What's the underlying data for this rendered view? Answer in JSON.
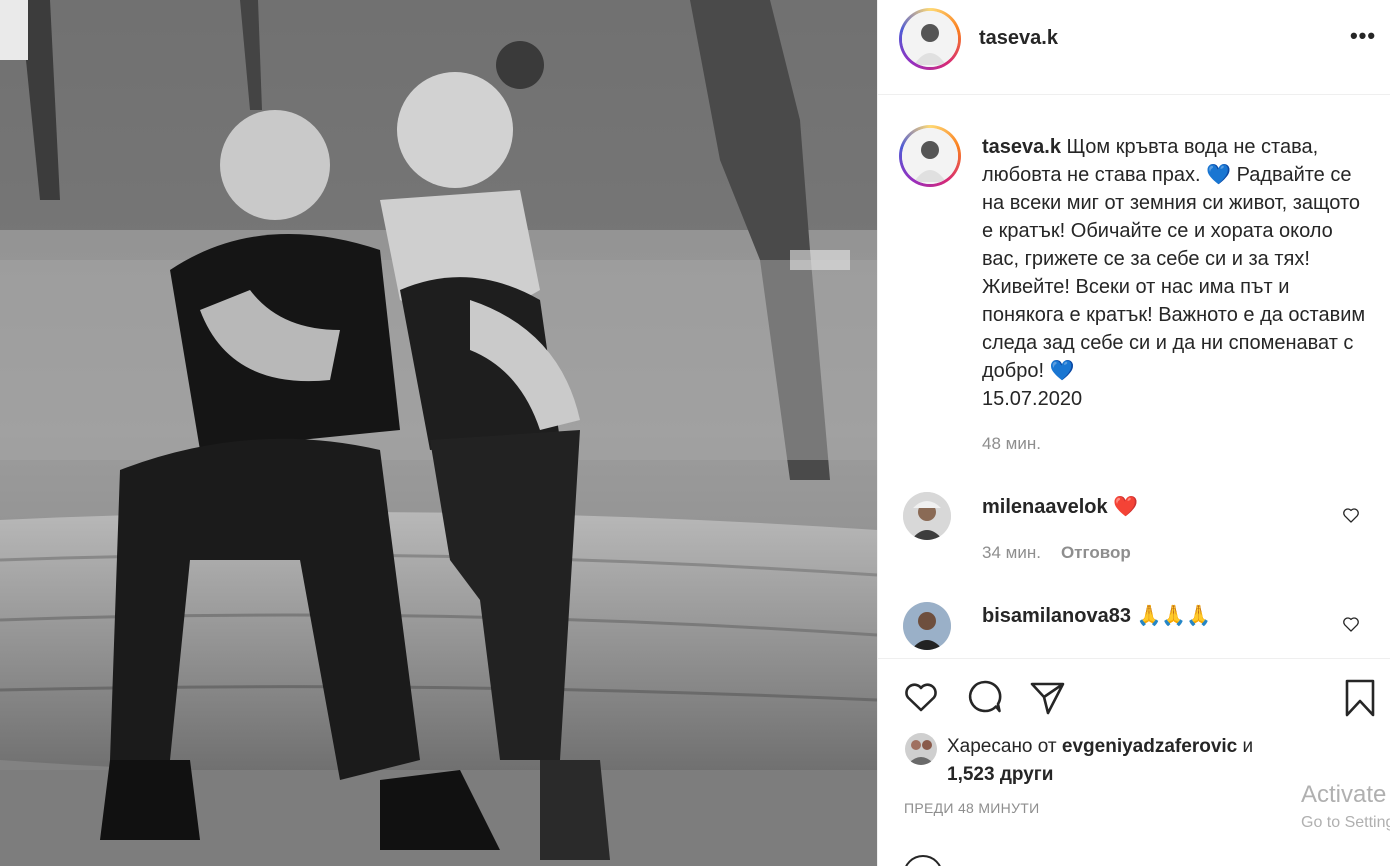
{
  "post": {
    "username": "taseva.k",
    "more_label": "•••",
    "caption": {
      "username": "taseva.k",
      "line1": " Щом кръвта вода не става, любовта не става прах. ",
      "heart1": "💙",
      "line2": " Радвайте се на всеки миг от земния си живот, защото е кратък! Обичайте се и хората около вас, грижете се за себе си и за тях! Живейте! Всеки от нас има път и понякога е кратък! Важното е да оставим следа зад себе си и да ни споменават с добро! ",
      "heart2": "💙",
      "date": "15.07.2020"
    },
    "caption_time": "48 мин."
  },
  "comments": [
    {
      "username": "milenaavelok",
      "text": "❤️",
      "time": "34 мин.",
      "reply_label": "Отговор"
    },
    {
      "username": "bisamilanova83",
      "text": "🙏🙏🙏"
    }
  ],
  "likes": {
    "prefix": "Харесано от ",
    "user": "evgeniyadzaferovic",
    "mid": " и ",
    "count": "1,523 други"
  },
  "posted_ago": "ПРЕДИ 48 МИНУТИ",
  "watermark": {
    "line1": "Activate Windows",
    "line2": "Go to Settings to activate Windows."
  },
  "icons": {
    "like": "heart-outline-icon",
    "comment": "speech-bubble-icon",
    "share": "paper-plane-icon",
    "save": "bookmark-icon"
  },
  "colors": {
    "text": "#262626",
    "secondary": "#8e8e8e",
    "border": "#efefef",
    "heart_red": "#ed4956"
  }
}
